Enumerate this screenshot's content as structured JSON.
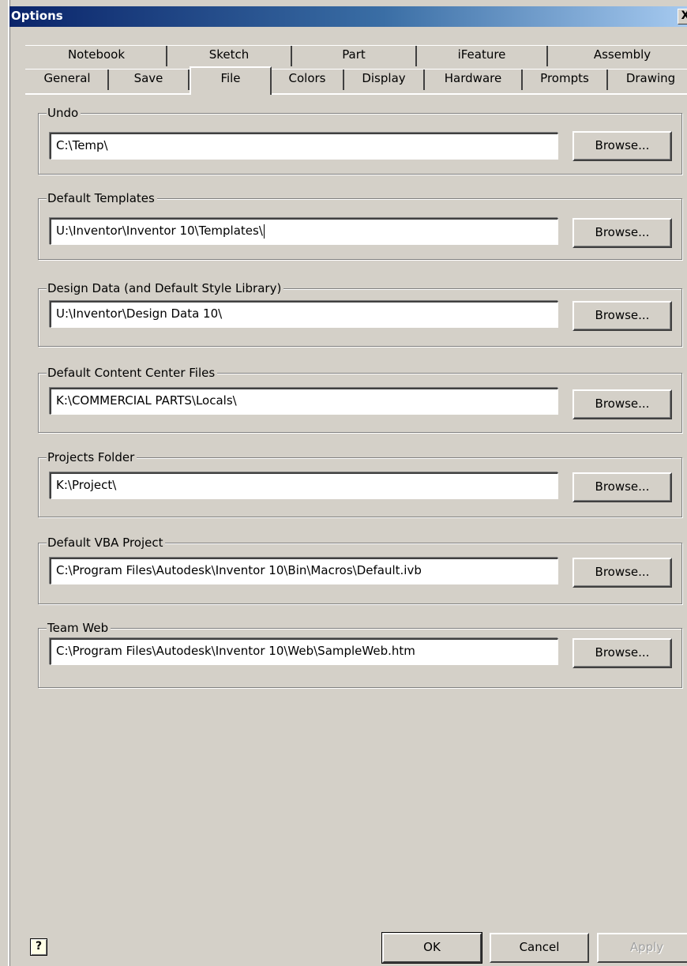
{
  "window": {
    "title": "Options",
    "close_label": "X"
  },
  "tabs": {
    "top_row": [
      "Notebook",
      "Sketch",
      "Part",
      "iFeature",
      "Assembly"
    ],
    "bottom_row": [
      "General",
      "Save",
      "File",
      "Colors",
      "Display",
      "Hardware",
      "Prompts",
      "Drawing"
    ],
    "active": "File"
  },
  "groups": {
    "undo": {
      "label": "Undo",
      "value": "C:\\Temp\\",
      "button": "Browse..."
    },
    "templates": {
      "label": "Default Templates",
      "value": "U:\\Inventor\\Inventor 10\\Templates\\",
      "button": "Browse..."
    },
    "design_data": {
      "label": "Design Data (and Default Style Library)",
      "value": "U:\\Inventor\\Design Data 10\\",
      "button": "Browse..."
    },
    "content_center": {
      "label": "Default Content Center Files",
      "value": "K:\\COMMERCIAL PARTS\\Locals\\",
      "button": "Browse..."
    },
    "projects": {
      "label": "Projects Folder",
      "value": "K:\\Project\\",
      "button": "Browse..."
    },
    "vba": {
      "label": "Default VBA Project",
      "value": "C:\\Program Files\\Autodesk\\Inventor 10\\Bin\\Macros\\Default.ivb",
      "button": "Browse..."
    },
    "team_web": {
      "label": "Team Web",
      "value": "C:\\Program Files\\Autodesk\\Inventor 10\\Web\\SampleWeb.htm",
      "button": "Browse..."
    }
  },
  "footer": {
    "help_label": "?",
    "ok": "OK",
    "cancel": "Cancel",
    "apply": "Apply"
  }
}
